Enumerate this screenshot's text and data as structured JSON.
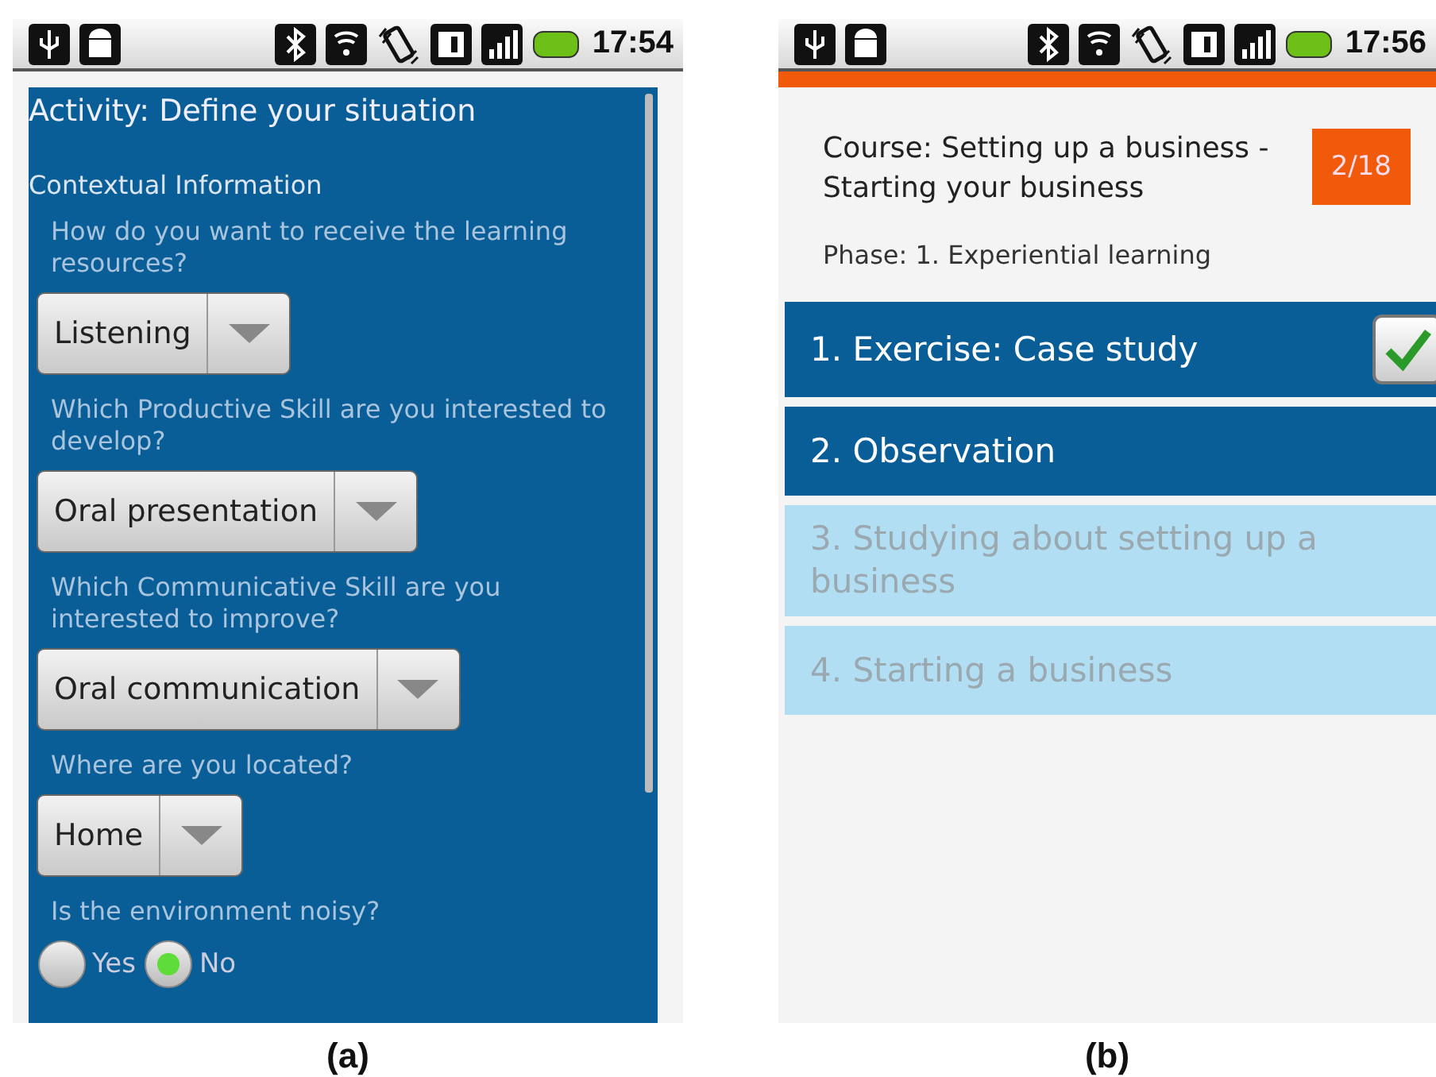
{
  "screens": [
    {
      "caption": "(a)",
      "status_bar": {
        "time": "17:54"
      },
      "kind": "form",
      "title": "Activity: Define your situation",
      "section": "Contextual Information",
      "questions": [
        {
          "kind": "dropdown",
          "label": "How do you want to receive the learning resources?",
          "value": "Listening"
        },
        {
          "kind": "dropdown",
          "label": "Which Productive Skill are you interested to develop?",
          "value": "Oral presentation"
        },
        {
          "kind": "dropdown",
          "label": "Which Communicative Skill are you interested to improve?",
          "value": "Oral communication"
        },
        {
          "kind": "dropdown",
          "label": "Where are you located?",
          "value": "Home"
        },
        {
          "kind": "radio",
          "label": "Is the environment noisy?",
          "options": [
            {
              "label": "Yes",
              "selected": false
            },
            {
              "label": "No",
              "selected": true
            }
          ]
        }
      ]
    },
    {
      "caption": "(b)",
      "status_bar": {
        "time": "17:56"
      },
      "kind": "course",
      "course": "Course: Setting up a business - Starting your business",
      "badge": "2/18",
      "phase": "Phase: 1. Experiential learning",
      "activities": [
        {
          "label": "1. Exercise: Case study",
          "enabled": true,
          "done": true
        },
        {
          "label": "2. Observation",
          "enabled": true,
          "done": false
        },
        {
          "label": "3. Studying about setting up a business",
          "enabled": false,
          "done": false
        },
        {
          "label": "4. Starting a business",
          "enabled": false,
          "done": false
        }
      ]
    }
  ]
}
